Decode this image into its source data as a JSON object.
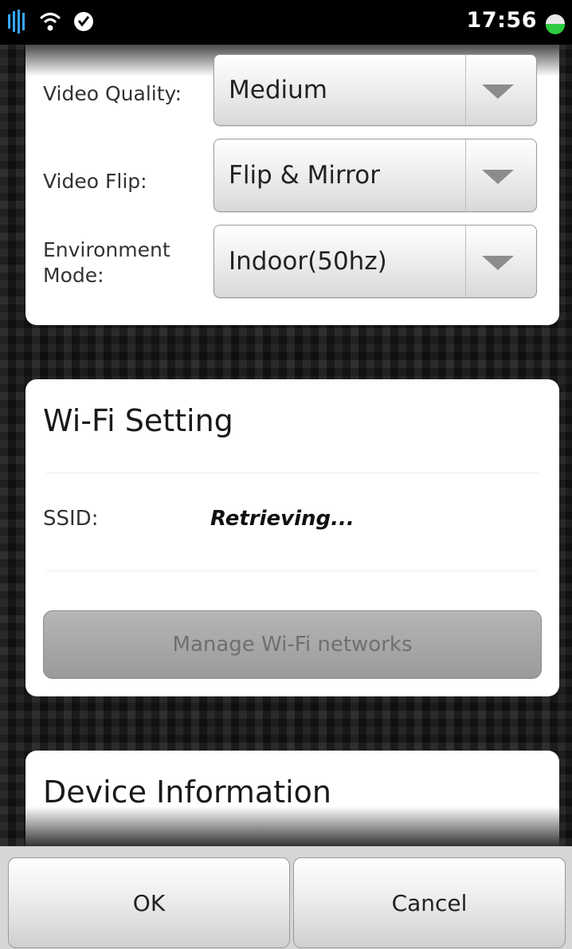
{
  "status_bar": {
    "time": "17:56",
    "icons": [
      "signal-icon",
      "wifi-icon",
      "app-icon",
      "battery-icon"
    ]
  },
  "video_settings": {
    "quality": {
      "label": "Video Quality:",
      "value": "Medium"
    },
    "flip": {
      "label": "Video Flip:",
      "value": "Flip & Mirror"
    },
    "environment": {
      "label_line1": "Environment",
      "label_line2": "Mode:",
      "value": "Indoor(50hz)"
    }
  },
  "wifi_setting": {
    "title": "Wi-Fi Setting",
    "ssid_label": "SSID:",
    "ssid_value": "Retrieving...",
    "manage_button": "Manage Wi-Fi networks"
  },
  "device_information": {
    "title": "Device Information"
  },
  "footer": {
    "ok_label": "OK",
    "cancel_label": "Cancel"
  },
  "colors": {
    "status_bar_bg": "#000000",
    "card_bg": "#ffffff",
    "battery_green": "#2ecc40"
  }
}
